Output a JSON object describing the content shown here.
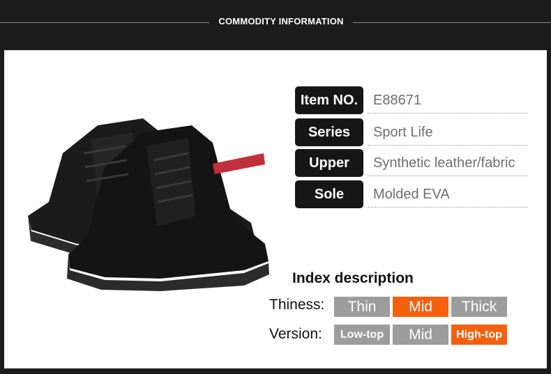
{
  "header": {
    "title": "COMMODITY  INFORMATION"
  },
  "specs": [
    {
      "label": "Item NO.",
      "value": "E88671"
    },
    {
      "label": "Series",
      "value": "Sport Life"
    },
    {
      "label": "Upper",
      "value": "Synthetic leather/fabric"
    },
    {
      "label": "Sole",
      "value": "Molded EVA"
    }
  ],
  "index": {
    "title": "Index description",
    "thickness": {
      "label": "Thiness:",
      "options": [
        "Thin",
        "Mid",
        "Thick"
      ],
      "selected": "Mid"
    },
    "version": {
      "label": "Version:",
      "options": [
        "Low-top",
        "Mid",
        "High-top"
      ],
      "selected": "High-top"
    }
  },
  "colors": {
    "accent": "#f5600f",
    "chip_grey": "#9c9c9c",
    "label_bg": "#161616"
  }
}
